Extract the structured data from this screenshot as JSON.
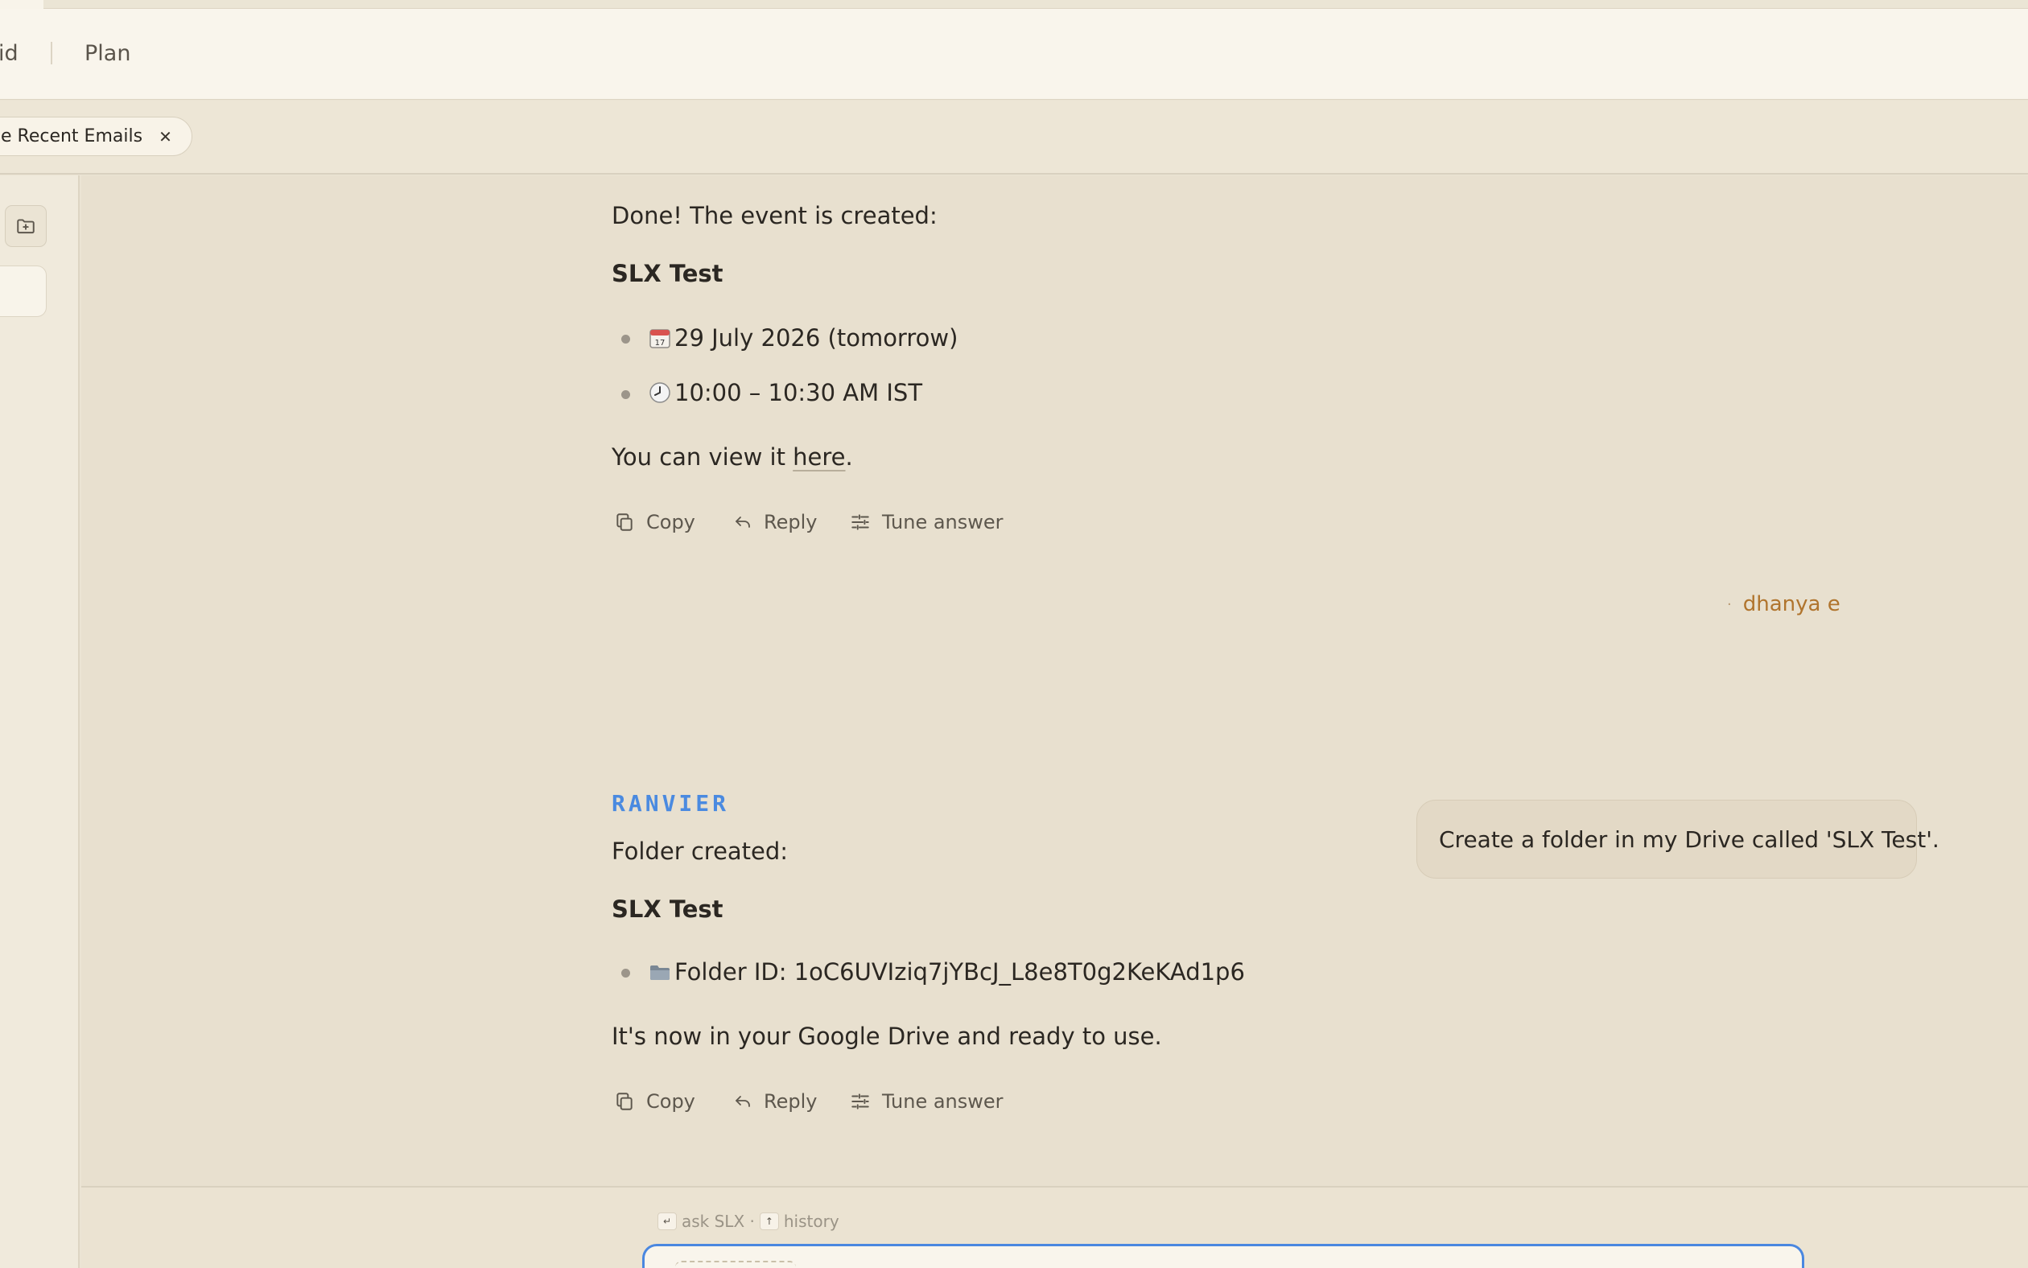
{
  "header": {
    "nav_left_partial": "id",
    "nav_plan": "Plan"
  },
  "tabbar": {
    "chip_label": "e Recent Emails",
    "chip_close": "✕"
  },
  "sidebar": {
    "folder_button_icon": "folder-plus-icon"
  },
  "messages": {
    "event": {
      "intro": "Done! The event is created:",
      "title": "SLX Test",
      "items": [
        {
          "emoji": "calendar-icon",
          "text": "29 July 2026 (tomorrow)"
        },
        {
          "emoji": "clock-icon",
          "text": "10:00 – 10:30 AM IST"
        }
      ],
      "view_prefix": "You can view it ",
      "view_link": "here",
      "view_suffix": "."
    },
    "user": {
      "dot": "·",
      "name": "dhanya e",
      "text": "Create a folder in my Drive called 'SLX Test'."
    },
    "folder": {
      "sender": "RANVIER",
      "intro": "Folder created:",
      "title": "SLX Test",
      "items": [
        {
          "emoji": "folder-icon",
          "text": "Folder ID: 1oC6UVIziq7jYBcJ_L8e8T0g2KeKAd1p6"
        }
      ],
      "outro": "It's now in your Google Drive and ready to use."
    },
    "actions": {
      "copy": "Copy",
      "reply": "Reply",
      "tune": "Tune answer"
    }
  },
  "composer": {
    "enter_key": "↵",
    "ask_hint": "ask SLX ·",
    "up_key": "↑",
    "history_hint": "history"
  },
  "colors": {
    "accent_blue": "#4a8ae0",
    "user_name": "#b0742d",
    "background": "#e8e0cf"
  }
}
